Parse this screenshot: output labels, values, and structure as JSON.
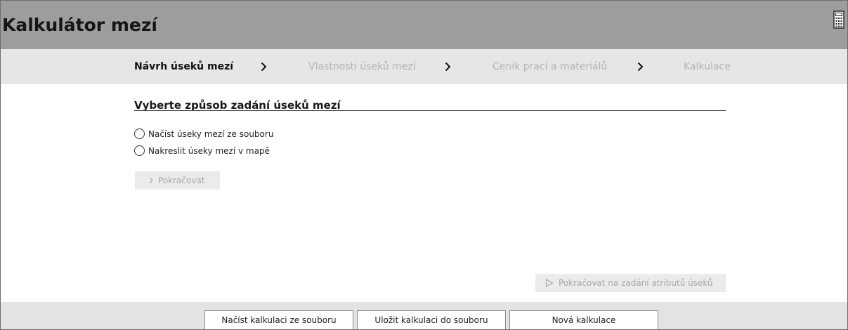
{
  "app": {
    "title": "Kalkulátor mezí",
    "title_icon": "calculator-icon"
  },
  "steps": [
    {
      "label": "Návrh úseků mezí",
      "active": true
    },
    {
      "label": "Vlastnosti úseků mezí",
      "active": false
    },
    {
      "label": "Ceník prací a materiálů",
      "active": false
    },
    {
      "label": "Kalkulace",
      "active": false
    }
  ],
  "main": {
    "section_title": "Vyberte způsob zadání úseků mezí",
    "options": [
      {
        "label": "Načíst úseky mezí ze souboru",
        "selected": false
      },
      {
        "label": "Nakreslit úseky mezí v mapě",
        "selected": false
      }
    ],
    "continue_label": "Pokračovat",
    "continue_attrs_label": "Pokračovat na zadání atributů úseků"
  },
  "footer": {
    "load_label": "Načíst kalkulaci ze souboru",
    "save_label": "Uložit kalkulaci do souboru",
    "new_label": "Nová kalkulace"
  },
  "colors": {
    "titlebar": "#9d9d9d",
    "stepbar": "#e6e6e6",
    "step_active": "#111111",
    "step_inactive": "#b4b4b4",
    "disabled_bg": "#ebebeb",
    "disabled_text": "#a6a6a6",
    "footer": "#e3e3e3"
  }
}
